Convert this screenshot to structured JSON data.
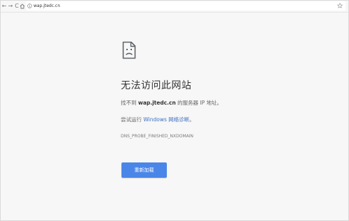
{
  "toolbar": {
    "back_glyph": "←",
    "forward_glyph": "→",
    "reload_glyph": "C",
    "address": "wap.jtedc.cn"
  },
  "error": {
    "title": "无法访问此网站",
    "desc_prefix": "找不到 ",
    "host": "wap.jtedc.cn",
    "desc_suffix": " 的服务器 IP 地址。",
    "suggest_prefix": "尝试运行 ",
    "suggest_link": "Windows 网络诊断",
    "suggest_suffix": "。",
    "code": "DNS_PROBE_FINISHED_NXDOMAIN",
    "reload_label": "重新加载"
  },
  "colors": {
    "accent": "#4a86e8",
    "link": "#3a6fc4",
    "background": "#f7f7f7"
  },
  "icons": [
    "back-icon",
    "forward-icon",
    "reload-icon",
    "home-icon",
    "info-icon",
    "star-icon",
    "sad-page-icon"
  ]
}
